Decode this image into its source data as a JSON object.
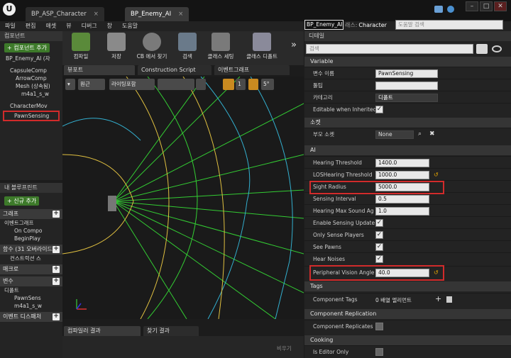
{
  "window": {
    "logo": "U",
    "tabs": [
      "BP_ASP_Character",
      "BP_Enemy_AI"
    ],
    "tab_close": "×",
    "controls": [
      "–",
      "□",
      "✕"
    ]
  },
  "menu": [
    "파일",
    "편집",
    "애셋",
    "뷰",
    "디버그",
    "창",
    "도움말"
  ],
  "header": {
    "bp_name": "BP_Enemy_AI",
    "parent_label": "래스:",
    "parent_class": "Character",
    "search_placeholder": "도움말 검색"
  },
  "components": {
    "title": "컴포넌트",
    "add_button": "+ 컴포넌트 추가",
    "root": "BP_Enemy_AI (자",
    "items": [
      "CapsuleComp",
      "ArrowComp",
      "Mesh (상속됨)",
      "m4a1_s_w",
      "CharacterMov",
      "PawnSensing"
    ]
  },
  "mybp": {
    "title": "내 블루프린트",
    "add_button": "+ 신규 추가",
    "sections": [
      {
        "name": "그래프",
        "items": []
      },
      {
        "name": "이벤트그래프",
        "items": [
          "On Compo",
          "BeginPlay"
        ]
      },
      {
        "name": "함수 (31 오버라이드",
        "items": [
          "컨스트럭션 스"
        ]
      },
      {
        "name": "매크로",
        "items": []
      },
      {
        "name": "변수",
        "items": []
      },
      {
        "name": "디폴트",
        "items": [
          "PawnSens",
          "m4a1_s_w"
        ]
      },
      {
        "name": "이벤트 디스패처",
        "items": []
      }
    ]
  },
  "toolbar": {
    "buttons": [
      "컴파일",
      "저장",
      "CB 에서 찾기",
      "검색",
      "클래스 세팅",
      "클래스 디폴트"
    ],
    "more": "»"
  },
  "viewport": {
    "tabs": [
      "뷰포트",
      "Construction Script",
      "이벤트그래프"
    ],
    "tools": [
      "원근",
      "라이팅포함"
    ],
    "grid": "1",
    "angle": "5°"
  },
  "bottom": {
    "tabs": [
      "컴파일러 결과",
      "찾기 결과"
    ],
    "clear": "비우기"
  },
  "details": {
    "title": "디테일",
    "search_placeholder": "검색",
    "groups": [
      {
        "name": "Variable",
        "rows": [
          {
            "label": "변수 이름",
            "value": "PawnSensing"
          },
          {
            "label": "툴팁",
            "value": ""
          },
          {
            "label": "카테고리",
            "value": "디폴트"
          },
          {
            "label": "Editable when Inherited",
            "value": "✓"
          }
        ]
      },
      {
        "name": "소켓",
        "rows": [
          {
            "label": "부모 소켓",
            "value": "None"
          }
        ]
      },
      {
        "name": "AI",
        "rows": [
          {
            "label": "Hearing Threshold",
            "value": "1400.0"
          },
          {
            "label": "LOSHearing Threshold",
            "value": "1000.0"
          },
          {
            "label": "Sight Radius",
            "value": "5000.0"
          },
          {
            "label": "Sensing Interval",
            "value": "0.5"
          },
          {
            "label": "Hearing Max Sound Ag",
            "value": "1.0"
          },
          {
            "label": "Enable Sensing Update",
            "value": "✓"
          },
          {
            "label": "Only Sense Players",
            "value": "✓"
          },
          {
            "label": "See Pawns",
            "value": "✓"
          },
          {
            "label": "Hear Noises",
            "value": "✓"
          },
          {
            "label": "Peripheral Vision Angle",
            "value": "40.0"
          }
        ]
      },
      {
        "name": "Tags",
        "rows": [
          {
            "label": "Component Tags",
            "value": "0 배열 엘리먼트"
          }
        ]
      },
      {
        "name": "Component Replication",
        "rows": [
          {
            "label": "Component Replicates",
            "value": ""
          }
        ]
      },
      {
        "name": "Cooking",
        "rows": [
          {
            "label": "Is Editor Only",
            "value": ""
          }
        ]
      }
    ]
  },
  "colors": {
    "sight_cone": "#33cc33",
    "hearing": "#e0c040",
    "los_hearing": "#33b0d0",
    "highlight": "#d12b2b"
  }
}
